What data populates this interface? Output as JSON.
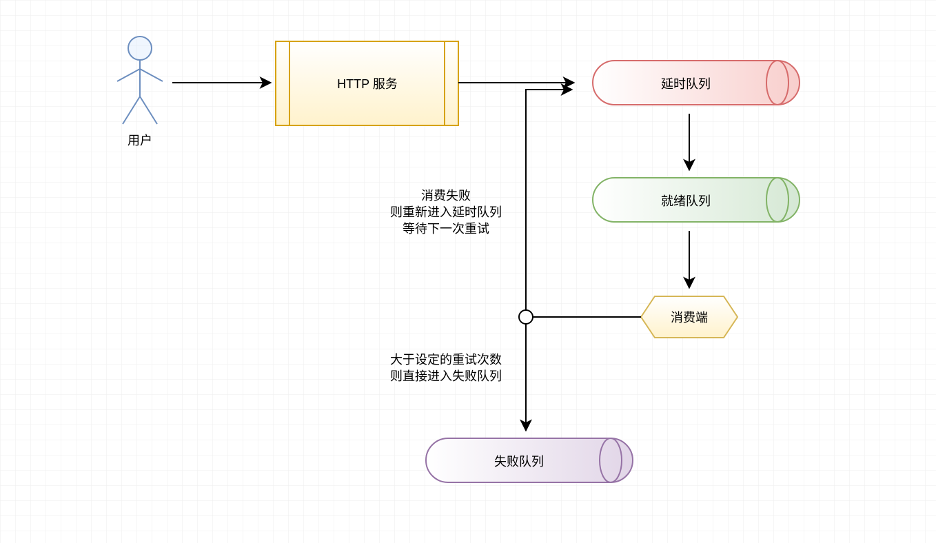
{
  "actor": {
    "label": "用户"
  },
  "http_service": {
    "label": "HTTP 服务"
  },
  "delay_queue": {
    "label": "延时队列"
  },
  "ready_queue": {
    "label": "就绪队列"
  },
  "consumer": {
    "label": "消费端"
  },
  "fail_queue": {
    "label": "失败队列"
  },
  "retry_note": {
    "line1": "消费失败",
    "line2": "则重新进入延时队列",
    "line3": "等待下一次重试"
  },
  "fail_note": {
    "line1": "大于设定的重试次数",
    "line2": "则直接进入失败队列"
  },
  "colors": {
    "grid": "#ededed",
    "actor_stroke": "#6c8ebf",
    "http_border": "#d6a200",
    "http_fill": "#fff2cc",
    "delay_border": "#d66b6b",
    "ready_border": "#82b366",
    "fail_border": "#9673a6",
    "consumer_border": "#d6b656",
    "consumer_fill": "#fff2cc",
    "arrow": "#000000",
    "text": "#000000"
  }
}
